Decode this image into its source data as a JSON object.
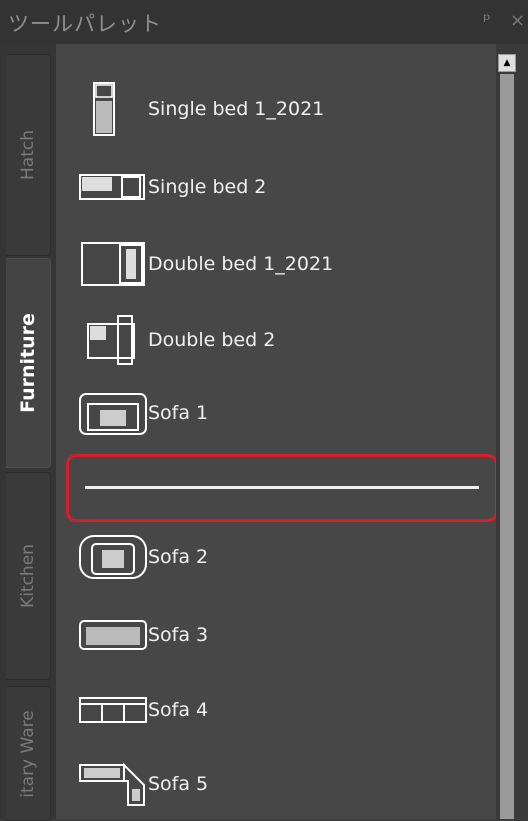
{
  "title": "ツールパレット",
  "title_controls": {
    "pin": "ᵖ",
    "close": "×"
  },
  "tabs": [
    {
      "label": "Hatch",
      "active": false
    },
    {
      "label": "Furniture",
      "active": true
    },
    {
      "label": "Kitchen",
      "active": false
    },
    {
      "label": "itary Ware",
      "active": false
    }
  ],
  "tools": [
    {
      "label": "Single bed 1_2021",
      "icon": "single-bed-1-icon"
    },
    {
      "label": "Single bed 2",
      "icon": "single-bed-2-icon"
    },
    {
      "label": "Double bed 1_2021",
      "icon": "double-bed-1-icon"
    },
    {
      "label": "Double bed 2",
      "icon": "double-bed-2-icon"
    },
    {
      "label": "Sofa 1",
      "icon": "sofa-1-icon"
    },
    {
      "label": "Sofa 2",
      "icon": "sofa-2-icon"
    },
    {
      "label": "Sofa 3",
      "icon": "sofa-3-icon"
    },
    {
      "label": "Sofa 4",
      "icon": "sofa-4-icon"
    },
    {
      "label": "Sofa 5",
      "icon": "sofa-5-icon"
    }
  ],
  "separator": {
    "highlighted": true,
    "highlight_color": "#d1202a"
  },
  "colors": {
    "background": "#474747",
    "title": "#8f8f8f",
    "text": "#f0f0f0"
  }
}
